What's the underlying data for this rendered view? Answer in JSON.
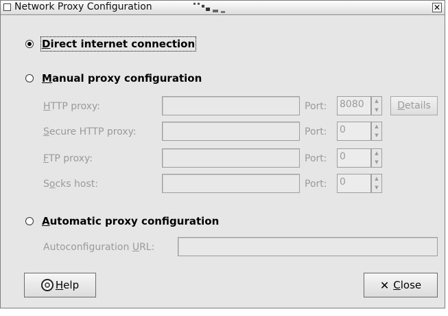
{
  "window": {
    "title": "Network Proxy Configuration",
    "close_glyph": "✕"
  },
  "options": {
    "direct": {
      "label_prefix": "",
      "label_accel": "D",
      "label_rest": "irect internet connection",
      "checked": true
    },
    "manual": {
      "label_prefix": "",
      "label_accel": "M",
      "label_rest": "anual proxy configuration",
      "checked": false
    },
    "automatic": {
      "label_prefix": "",
      "label_accel": "A",
      "label_rest": "utomatic proxy configuration",
      "checked": false
    }
  },
  "manual_fields": [
    {
      "label_pre": "",
      "label_accel": "H",
      "label_post": "TTP proxy:",
      "value": "",
      "port_label": "Port:",
      "port": "8080"
    },
    {
      "label_pre": "",
      "label_accel": "S",
      "label_post": "ecure HTTP proxy:",
      "value": "",
      "port_label": "Port:",
      "port": "0"
    },
    {
      "label_pre": "",
      "label_accel": "F",
      "label_post": "TP proxy:",
      "value": "",
      "port_label": "Port:",
      "port": "0"
    },
    {
      "label_pre": "S",
      "label_accel": "o",
      "label_post": "cks host:",
      "value": "",
      "port_label": "Port:",
      "port": "0"
    }
  ],
  "details_button": {
    "accel": "D",
    "rest": "etails"
  },
  "autoconfig": {
    "label_pre": "Autoconfiguration ",
    "label_accel": "U",
    "label_post": "RL:",
    "value": ""
  },
  "help_button": {
    "accel": "H",
    "rest": "elp"
  },
  "close_button": {
    "accel": "C",
    "rest": "lose"
  },
  "colors": {
    "window_bg": "#e6e6e6",
    "disabled_text": "#9a9a9a"
  }
}
